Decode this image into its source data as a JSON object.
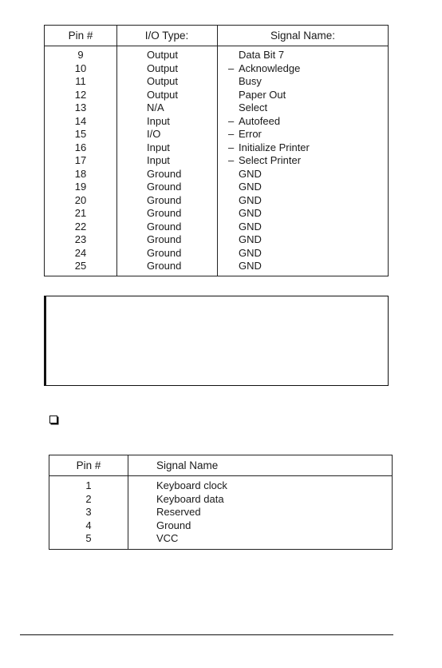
{
  "parallel_table": {
    "headers": {
      "pin": "Pin #",
      "io_type": "I/O Type:",
      "signal": "Signal Name:"
    },
    "rows": [
      {
        "pin": "9",
        "io_type": "Output",
        "active_low": "",
        "signal": "Data Bit 7"
      },
      {
        "pin": "10",
        "io_type": "Output",
        "active_low": "–",
        "signal": "Acknowledge"
      },
      {
        "pin": "11",
        "io_type": "Output",
        "active_low": "",
        "signal": "Busy"
      },
      {
        "pin": "12",
        "io_type": "Output",
        "active_low": "",
        "signal": "Paper Out"
      },
      {
        "pin": "13",
        "io_type": "N/A",
        "active_low": "",
        "signal": "Select"
      },
      {
        "pin": "14",
        "io_type": "Input",
        "active_low": "–",
        "signal": "Autofeed"
      },
      {
        "pin": "15",
        "io_type": "I/O",
        "active_low": "–",
        "signal": "Error"
      },
      {
        "pin": "16",
        "io_type": "Input",
        "active_low": "–",
        "signal": "Initialize Printer"
      },
      {
        "pin": "17",
        "io_type": "Input",
        "active_low": "–",
        "signal": "Select Printer"
      },
      {
        "pin": "18",
        "io_type": "Ground",
        "active_low": "",
        "signal": "GND"
      },
      {
        "pin": "19",
        "io_type": "Ground",
        "active_low": "",
        "signal": "GND"
      },
      {
        "pin": "20",
        "io_type": "Ground",
        "active_low": "",
        "signal": "GND"
      },
      {
        "pin": "21",
        "io_type": "Ground",
        "active_low": "",
        "signal": "GND"
      },
      {
        "pin": "22",
        "io_type": "Ground",
        "active_low": "",
        "signal": "GND"
      },
      {
        "pin": "23",
        "io_type": "Ground",
        "active_low": "",
        "signal": "GND"
      },
      {
        "pin": "24",
        "io_type": "Ground",
        "active_low": "",
        "signal": "GND"
      },
      {
        "pin": "25",
        "io_type": "Ground",
        "active_low": "",
        "signal": "GND"
      }
    ]
  },
  "note_box": {
    "text": ""
  },
  "bullet": {
    "icon": "checkbox-bullet-icon",
    "text": ""
  },
  "keyboard_table": {
    "headers": {
      "pin": "Pin #",
      "signal": "Signal Name"
    },
    "rows": [
      {
        "pin": "1",
        "signal": "Keyboard clock"
      },
      {
        "pin": "2",
        "signal": "Keyboard data"
      },
      {
        "pin": "3",
        "signal": "Reserved"
      },
      {
        "pin": "4",
        "signal": "Ground"
      },
      {
        "pin": "5",
        "signal": "VCC"
      }
    ]
  }
}
